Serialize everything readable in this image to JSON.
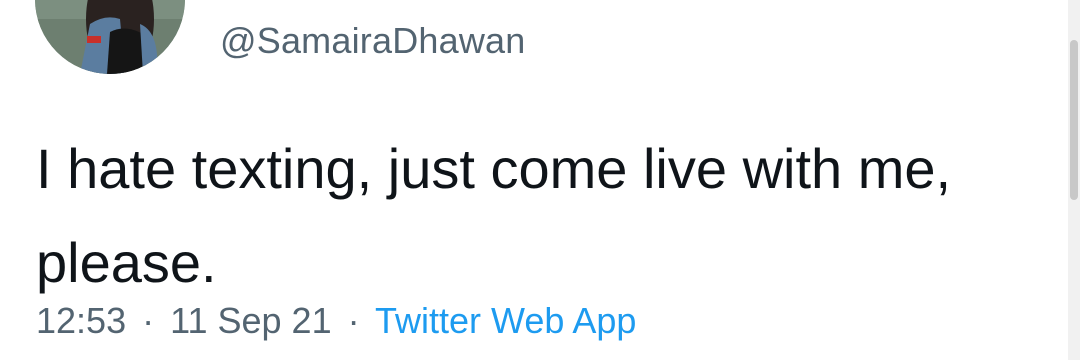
{
  "tweet": {
    "avatar": {
      "icon": "profile-photo",
      "colors": {
        "background": "#7c8f80",
        "hair": "#2a2220",
        "jacket": "#5b7da0",
        "top": "#151515",
        "accent": "#c8302a"
      }
    },
    "handle": "@SamairaDhawan",
    "text": "I hate texting, just come live with me, please.",
    "meta": {
      "time": "12:53",
      "separator": "·",
      "date": "11 Sep 21",
      "source": "Twitter Web App"
    },
    "colors": {
      "text": "#0f1419",
      "secondary": "#536471",
      "link": "#1d9bf0"
    }
  }
}
